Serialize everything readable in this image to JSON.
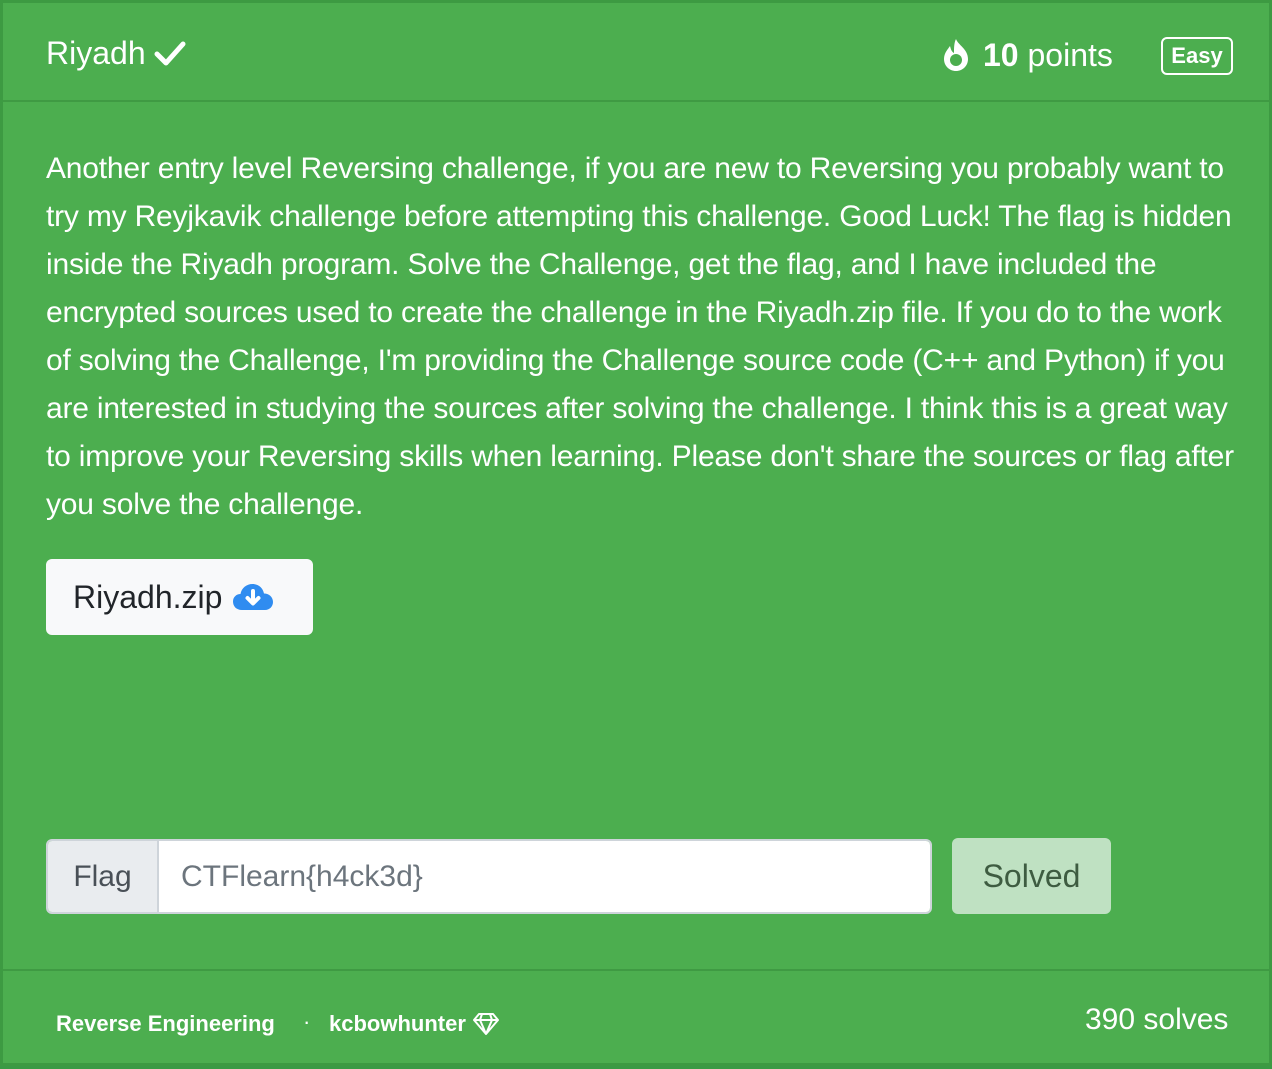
{
  "header": {
    "title": "Riyadh",
    "points_value": "10",
    "points_label": "points",
    "difficulty": "Easy"
  },
  "description": "Another entry level Reversing challenge, if you are new to Reversing you probably want to try my Reyjkavik challenge before attempting this challenge. Good Luck! The flag is hidden inside the Riyadh program. Solve the Challenge, get the flag, and I have included the encrypted sources used to create the challenge in the Riyadh.zip file. If you do to the work of solving the Challenge, I'm providing the Challenge source code (C++ and Python) if you are interested in studying the sources after solving the challenge. I think this is a great way to improve your Reversing skills when learning. Please don't share the sources or flag after you solve the challenge.",
  "download": {
    "label": "Riyadh.zip"
  },
  "flag_form": {
    "label": "Flag",
    "value": "CTFlearn{h4ck3d}",
    "submit_label": "Solved"
  },
  "footer": {
    "category": "Reverse Engineering",
    "separator": "·",
    "author": "kcbowhunter",
    "solves": "390 solves"
  },
  "colors": {
    "card_bg": "#4cae4f",
    "button_light": "#f8f9fa",
    "solved_btn": "#bfe1c2",
    "cloud_icon": "#2f8cf0"
  }
}
